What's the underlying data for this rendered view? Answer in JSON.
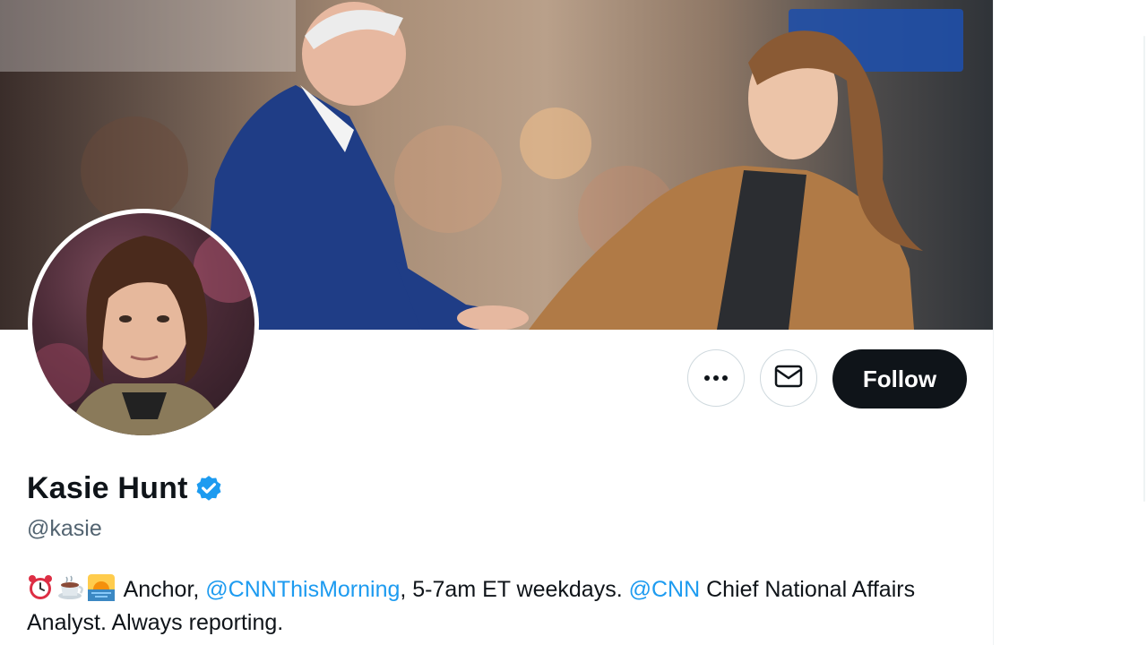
{
  "profile": {
    "display_name": "Kasie Hunt",
    "handle": "@kasie",
    "verified": true,
    "bio": {
      "emojis": [
        "alarm-clock",
        "hot-beverage",
        "sunrise"
      ],
      "text_1": " Anchor, ",
      "mention_1": "@CNNThisMorning",
      "text_2": ", 5-7am ET weekdays. ",
      "mention_2": "@CNN",
      "text_3": " Chief National Affairs Analyst. Always reporting."
    }
  },
  "actions": {
    "more_icon": "more-horizontal-icon",
    "message_icon": "envelope-icon",
    "follow_label": "Follow"
  },
  "colors": {
    "accent": "#1d9bf0",
    "text_primary": "#0f1419",
    "text_secondary": "#536471",
    "follow_bg": "#0f1419",
    "verified_badge": "#1d9bf0"
  }
}
